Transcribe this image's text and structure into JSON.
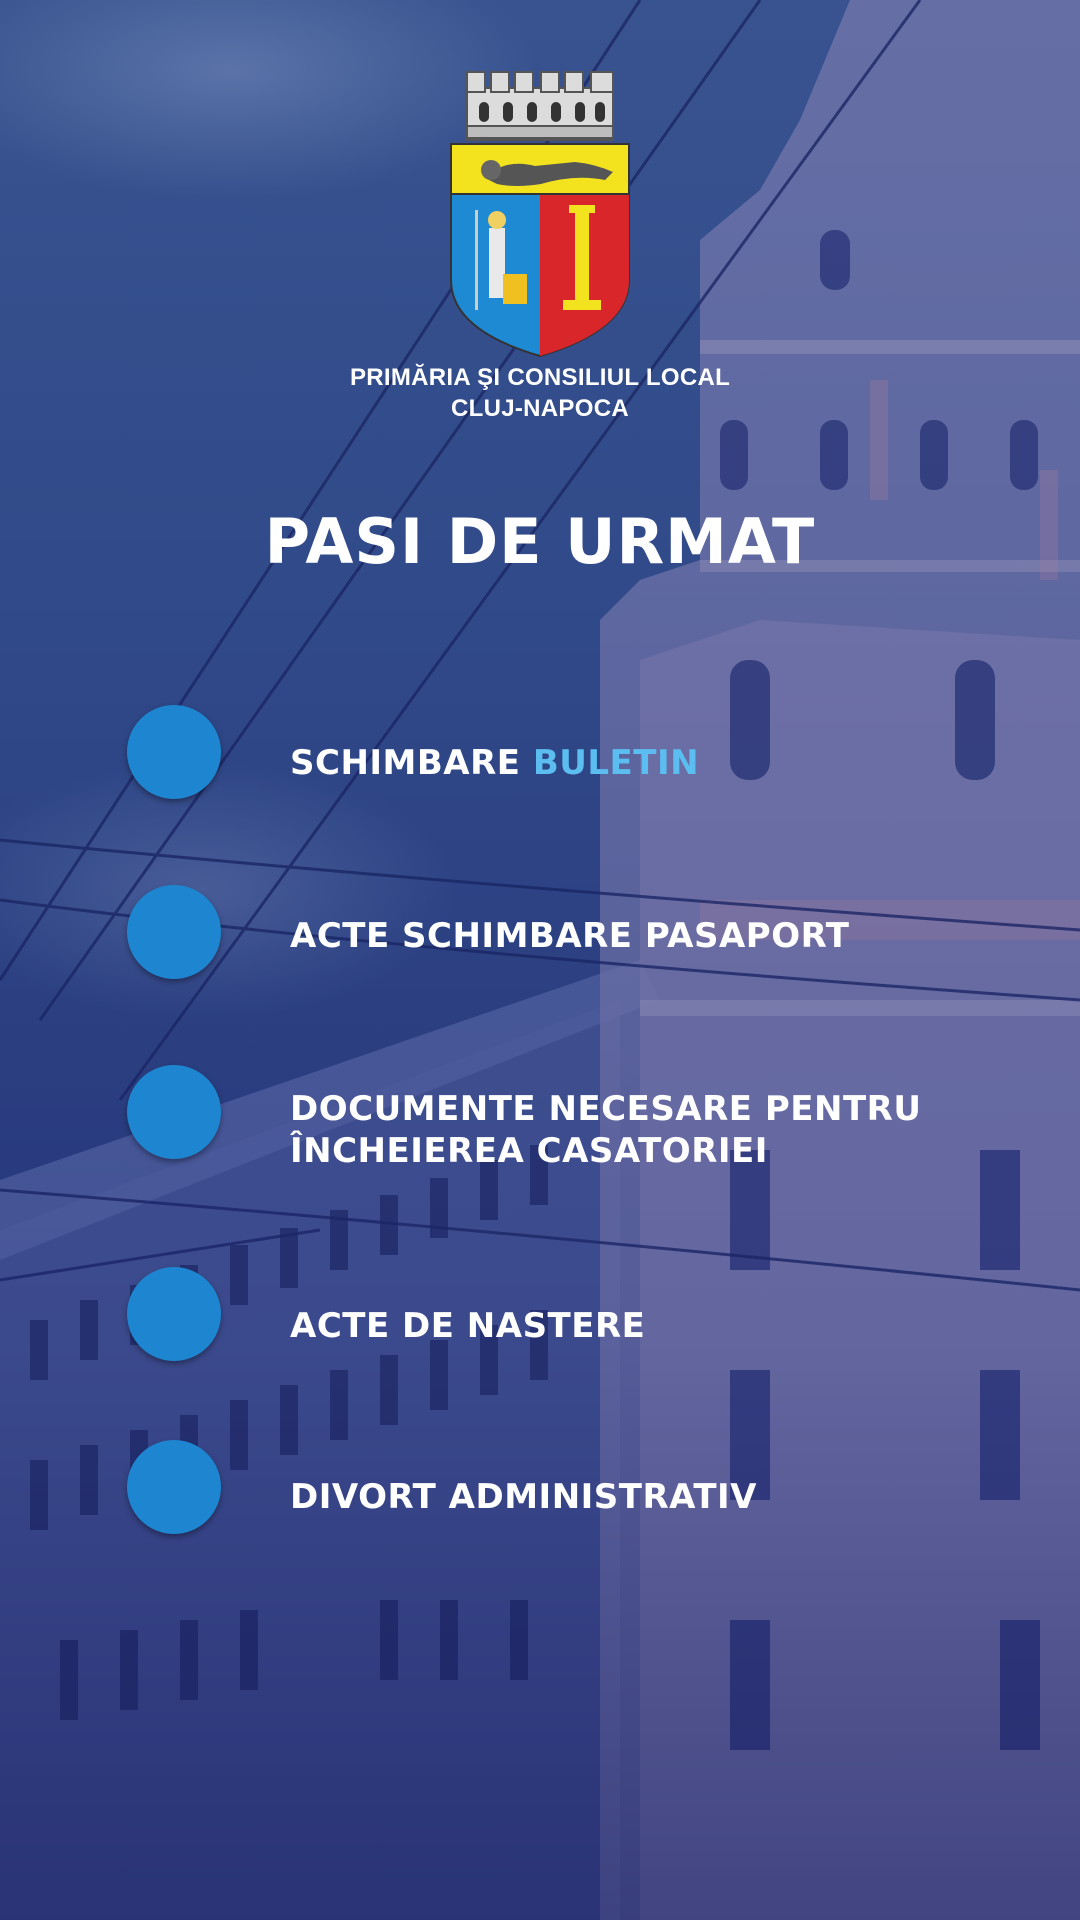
{
  "header": {
    "org_name_line1": "PRIMĂRIA ŞI CONSILIUL LOCAL",
    "org_name_line2": "CLUJ-NAPOCA",
    "logo_icon": "city-coat-of-arms-icon"
  },
  "title": "PASI DE URMAT",
  "steps": [
    {
      "label": "SCHIMBARE",
      "accent": "BULETIN"
    },
    {
      "label": "ACTE SCHIMBARE PASAPORT"
    },
    {
      "line1": "DOCUMENTE NECESARE PENTRU",
      "line2": "ÎNCHEIEREA CASATORIEI"
    },
    {
      "label": "ACTE DE NASTERE"
    },
    {
      "label": "DIVORT ADMINISTRATIV"
    }
  ],
  "colors": {
    "background": "#34508c",
    "circle": "#1e86d0",
    "accent_text": "#5bbdf0",
    "text": "#ffffff"
  }
}
